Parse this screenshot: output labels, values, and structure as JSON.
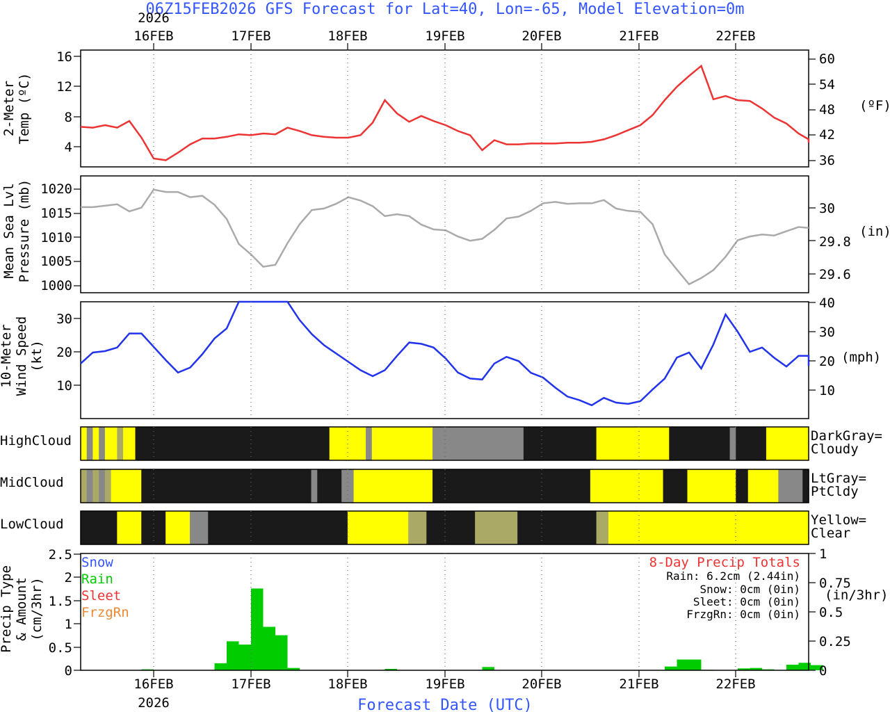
{
  "header": {
    "title": "06Z15FEB2026 GFS Forecast for Lat=40, Lon=-65, Model Elevation=0m"
  },
  "colors": {
    "title": "#3355ff",
    "temp": "#ee3333",
    "pressure": "#aaaaaa",
    "wind": "#2233ee",
    "precip": "#00cc00"
  },
  "date_axis": {
    "year": "2026",
    "labels": [
      "16FEB",
      "17FEB",
      "18FEB",
      "19FEB",
      "20FEB",
      "21FEB",
      "22FEB"
    ],
    "xlabel": "Forecast Date (UTC)"
  },
  "panels": {
    "temp": {
      "ylabel_1": "2-Meter",
      "ylabel_2": "Temp (ºC)",
      "units_right": "(ºF)",
      "ticks_left": [
        "4",
        "8",
        "12",
        "16"
      ],
      "ticks_right": [
        "36",
        "42",
        "48",
        "54",
        "60"
      ]
    },
    "pressure": {
      "ylabel_1": "Mean Sea Lvl",
      "ylabel_2": "Pressure (mb)",
      "units_right": "(in)",
      "ticks_left": [
        "1000",
        "1005",
        "1010",
        "1015",
        "1020"
      ],
      "ticks_right": [
        "29.6",
        "29.8",
        "30"
      ]
    },
    "wind": {
      "ylabel_1": "10-Meter",
      "ylabel_2": "Wind Speed",
      "ylabel_3": "(kt)",
      "units_right": "(mph)",
      "ticks_left": [
        "10",
        "20",
        "30"
      ],
      "ticks_right": [
        "10",
        "20",
        "30",
        "40"
      ]
    },
    "clouds": {
      "high": "HighCloud",
      "mid": "MidCloud",
      "low": "LowCloud",
      "legend_high_1": "DarkGray=",
      "legend_high_2": "Cloudy",
      "legend_mid_1": "LtGray=",
      "legend_mid_2": "PtCldy",
      "legend_low_1": "Yellow=",
      "legend_low_2": "Clear"
    },
    "precip": {
      "ylabel_1": "Precip Type",
      "ylabel_2": "& Amount",
      "ylabel_3": "(cm/3hr)",
      "units_right": "(in/3hr)",
      "ticks_left": [
        "0",
        "0.5",
        "1",
        "1.5",
        "2",
        "2.5"
      ],
      "ticks_right": [
        "0",
        "0.25",
        "0.5",
        "0.75",
        "1"
      ],
      "types": [
        "Snow",
        "Rain",
        "Sleet",
        "FrzgRn"
      ],
      "totals_title": "8-Day Precip Totals",
      "totals": [
        "Rain: 6.2cm (2.44in)",
        "Snow: 0cm (0in)",
        "Sleet: 0cm (0in)",
        "FrzgRn: 0cm (0in)"
      ]
    }
  },
  "chart_data": [
    {
      "type": "line",
      "title": "2-Meter Temp",
      "xlabel": "Forecast Date (UTC)",
      "ylabel": "Temp (ºC)",
      "ylim": [
        2.5,
        16.5
      ],
      "x_start": "15FEB 06Z",
      "x_step_hours": 3,
      "values": [
        7.3,
        7.2,
        7.5,
        7.2,
        8.0,
        6.0,
        3.5,
        3.3,
        4.2,
        5.2,
        5.9,
        5.9,
        6.1,
        6.4,
        6.3,
        6.5,
        6.4,
        7.2,
        6.8,
        6.3,
        6.1,
        6.0,
        6.0,
        6.3,
        7.8,
        10.5,
        8.9,
        7.9,
        8.6,
        8.0,
        7.5,
        6.8,
        6.3,
        4.5,
        5.7,
        5.2,
        5.2,
        5.3,
        5.3,
        5.3,
        5.4,
        5.4,
        5.5,
        5.8,
        6.3,
        6.9,
        7.5,
        8.7,
        10.5,
        12.1,
        13.4,
        14.6,
        10.6,
        11.0,
        10.5,
        10.4,
        9.5,
        8.4,
        7.7,
        6.5,
        5.8,
        5.4
      ]
    },
    {
      "type": "line",
      "title": "Mean Sea Lvl Pressure",
      "ylabel": "Pressure (mb)",
      "ylim": [
        998.7,
        1023.4
      ],
      "values": [
        1016.8,
        1016.8,
        1017.1,
        1017.4,
        1015.9,
        1016.7,
        1020.5,
        1020.0,
        1020.0,
        1018.9,
        1019.2,
        1017.3,
        1014.3,
        1009.0,
        1006.8,
        1004.2,
        1004.6,
        1009.2,
        1013.2,
        1016.2,
        1016.5,
        1017.5,
        1018.9,
        1018.2,
        1017.0,
        1014.9,
        1015.3,
        1014.9,
        1013.1,
        1012.1,
        1011.9,
        1010.6,
        1009.7,
        1010.1,
        1012.0,
        1014.4,
        1014.8,
        1016.0,
        1017.6,
        1017.9,
        1017.5,
        1017.6,
        1017.6,
        1018.3,
        1016.5,
        1016.0,
        1015.8,
        1013.2,
        1006.8,
        1003.6,
        1000.5,
        1001.8,
        1003.5,
        1006.3,
        1009.8,
        1010.6,
        1011.0,
        1010.8,
        1011.7,
        1012.6,
        1012.4
      ]
    },
    {
      "type": "line",
      "title": "10-Meter Wind Speed",
      "ylabel": "Wind Speed (kt)",
      "ylim": [
        0,
        35
      ],
      "values": [
        16.5,
        19.8,
        20.2,
        21.3,
        25.5,
        25.5,
        21.5,
        17.5,
        13.8,
        15.3,
        19.3,
        24.0,
        27.0,
        35.5,
        39.5,
        38.0,
        36.5,
        35.0,
        29.5,
        25.3,
        22.0,
        19.5,
        17.0,
        14.5,
        12.7,
        14.5,
        18.8,
        22.8,
        22.4,
        21.3,
        18.0,
        13.8,
        12.0,
        11.7,
        16.5,
        18.5,
        17.2,
        13.7,
        12.3,
        9.3,
        6.6,
        5.5,
        4.0,
        6.2,
        4.8,
        4.4,
        5.2,
        8.7,
        12.0,
        18.3,
        19.8,
        15.0,
        22.2,
        31.2,
        26.0,
        20.0,
        21.3,
        18.2,
        15.6,
        18.8,
        18.8,
        15.8
      ]
    },
    {
      "type": "bar",
      "title": "Precip Type & Amount",
      "ylabel": "(cm/3hr)",
      "ylim": [
        0,
        2.5
      ],
      "series": [
        {
          "name": "Rain",
          "values": [
            0,
            0,
            0,
            0,
            0,
            0.02,
            0,
            0,
            0,
            0,
            0,
            0.15,
            0.62,
            0.55,
            1.75,
            0.93,
            0.75,
            0.05,
            0,
            0,
            0,
            0,
            0,
            0,
            0,
            0.03,
            0,
            0,
            0,
            0,
            0,
            0,
            0,
            0.07,
            0,
            0,
            0,
            0,
            0,
            0,
            0,
            0,
            0,
            0,
            0,
            0,
            0,
            0,
            0.08,
            0.23,
            0.23,
            0.01,
            0,
            0,
            0.04,
            0.05,
            0.02,
            0,
            0.12,
            0.16,
            0.11
          ]
        }
      ]
    },
    {
      "type": "heatmap",
      "title": "HighCloud",
      "values": [
        0,
        2,
        0,
        2,
        0,
        0,
        1,
        0,
        0,
        3,
        3,
        3,
        3,
        3,
        3,
        3,
        3,
        3,
        3,
        3,
        3,
        3,
        3,
        3,
        3,
        3,
        3,
        3,
        3,
        3,
        3,
        3,
        3,
        3,
        3,
        3,
        3,
        3,
        3,
        3,
        3,
        0,
        0,
        0,
        0,
        0,
        0,
        2,
        0,
        0,
        0,
        0,
        0,
        0,
        0,
        0,
        0,
        0,
        2,
        2,
        2,
        2,
        2,
        2,
        2,
        2,
        2,
        2,
        2,
        2,
        2,
        2,
        2,
        3,
        3,
        3,
        3,
        3,
        3,
        3,
        3,
        3,
        3,
        3,
        3,
        0,
        0,
        0,
        0,
        0,
        0,
        0,
        0,
        0,
        0,
        0,
        0,
        3,
        3,
        3,
        3,
        3,
        3,
        3,
        3,
        3,
        3,
        2,
        3,
        3,
        3,
        3,
        3,
        0,
        0,
        0,
        0,
        0,
        0,
        0,
        0
      ]
    }
  ]
}
